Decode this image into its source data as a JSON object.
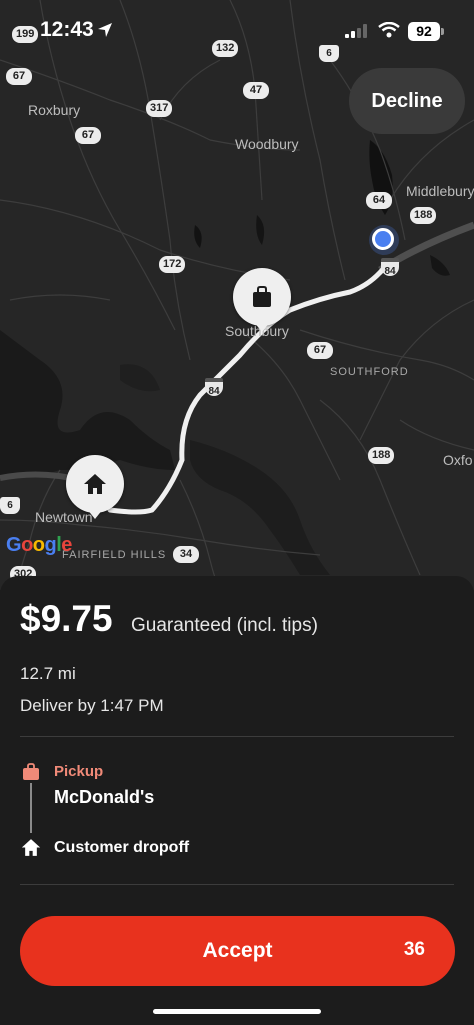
{
  "status_bar": {
    "time": "12:43",
    "battery": "92"
  },
  "map": {
    "decline_label": "Decline",
    "places": [
      "Roxbury",
      "Woodbury",
      "Middlebury",
      "Southbury",
      "SOUTHFORD",
      "Newtown",
      "Oxfo",
      "FAIRFIELD HILLS"
    ],
    "routes": [
      "199",
      "132",
      "6",
      "67",
      "47",
      "317",
      "67",
      "64",
      "188",
      "172",
      "84",
      "67",
      "84",
      "188",
      "6",
      "34",
      "302"
    ],
    "google": "Google"
  },
  "offer": {
    "price": "$9.75",
    "price_note": "Guaranteed (incl. tips)",
    "distance": "12.7 mi",
    "deliver_by": "Deliver by 1:47 PM",
    "pickup_label": "Pickup",
    "pickup_name": "McDonald's",
    "dropoff_label": "Customer dropoff",
    "accept_label": "Accept",
    "accept_countdown": "36"
  },
  "colors": {
    "accent": "#e8321e",
    "pickup_accent": "#f08a78",
    "location_dot": "#4a7ff0"
  }
}
